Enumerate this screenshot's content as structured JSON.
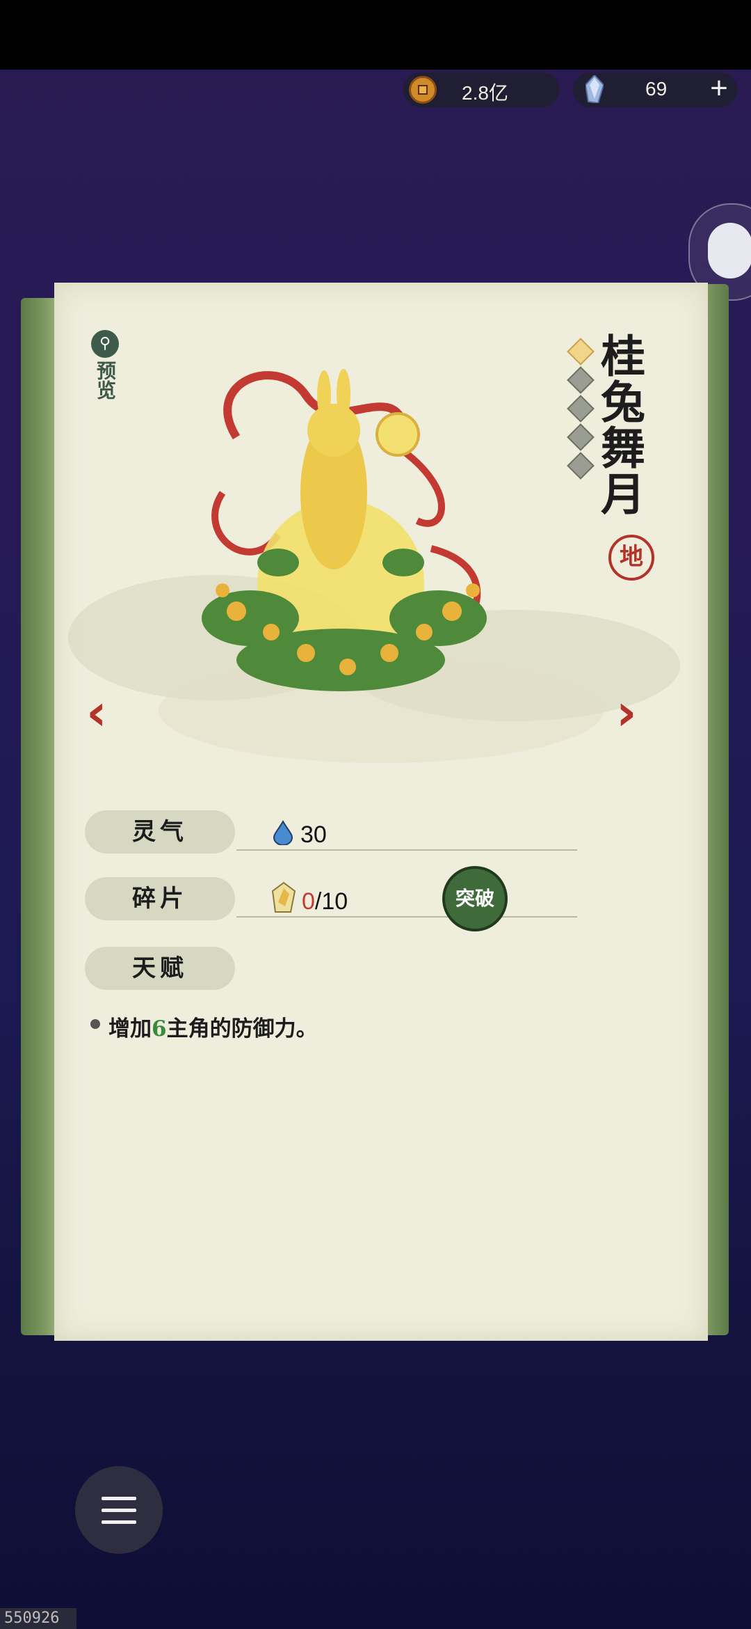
{
  "currency": {
    "coins": "2.8亿",
    "gems": "69",
    "coin_icon": "copper-coin-icon",
    "gem_icon": "spirit-crystal-icon"
  },
  "card": {
    "preview_label": "预览",
    "name": "桂兔舞月",
    "grade": "地",
    "star_count_total": 5,
    "stars_lit": 1,
    "stats": {
      "aura_label": "灵气",
      "aura_value": "30",
      "fragment_label": "碎片",
      "fragment_current": "0",
      "fragment_total": "/10",
      "talent_label": "天赋"
    },
    "breakthrough_button": "突破",
    "talent_desc_pre": "增加",
    "talent_desc_num": "6",
    "talent_desc_post": "主角的防御力。"
  },
  "nav": {
    "prev_icon": "chevron-left-icon",
    "next_icon": "chevron-right-icon",
    "menu_icon": "hamburger-menu-icon"
  },
  "build_id": "550926",
  "colors": {
    "accent_red": "#b3322a",
    "paper": "#efeddc",
    "border_green": "#7f9a62",
    "button_green": "#3f6b3a",
    "number_green": "#3a8a3a"
  }
}
